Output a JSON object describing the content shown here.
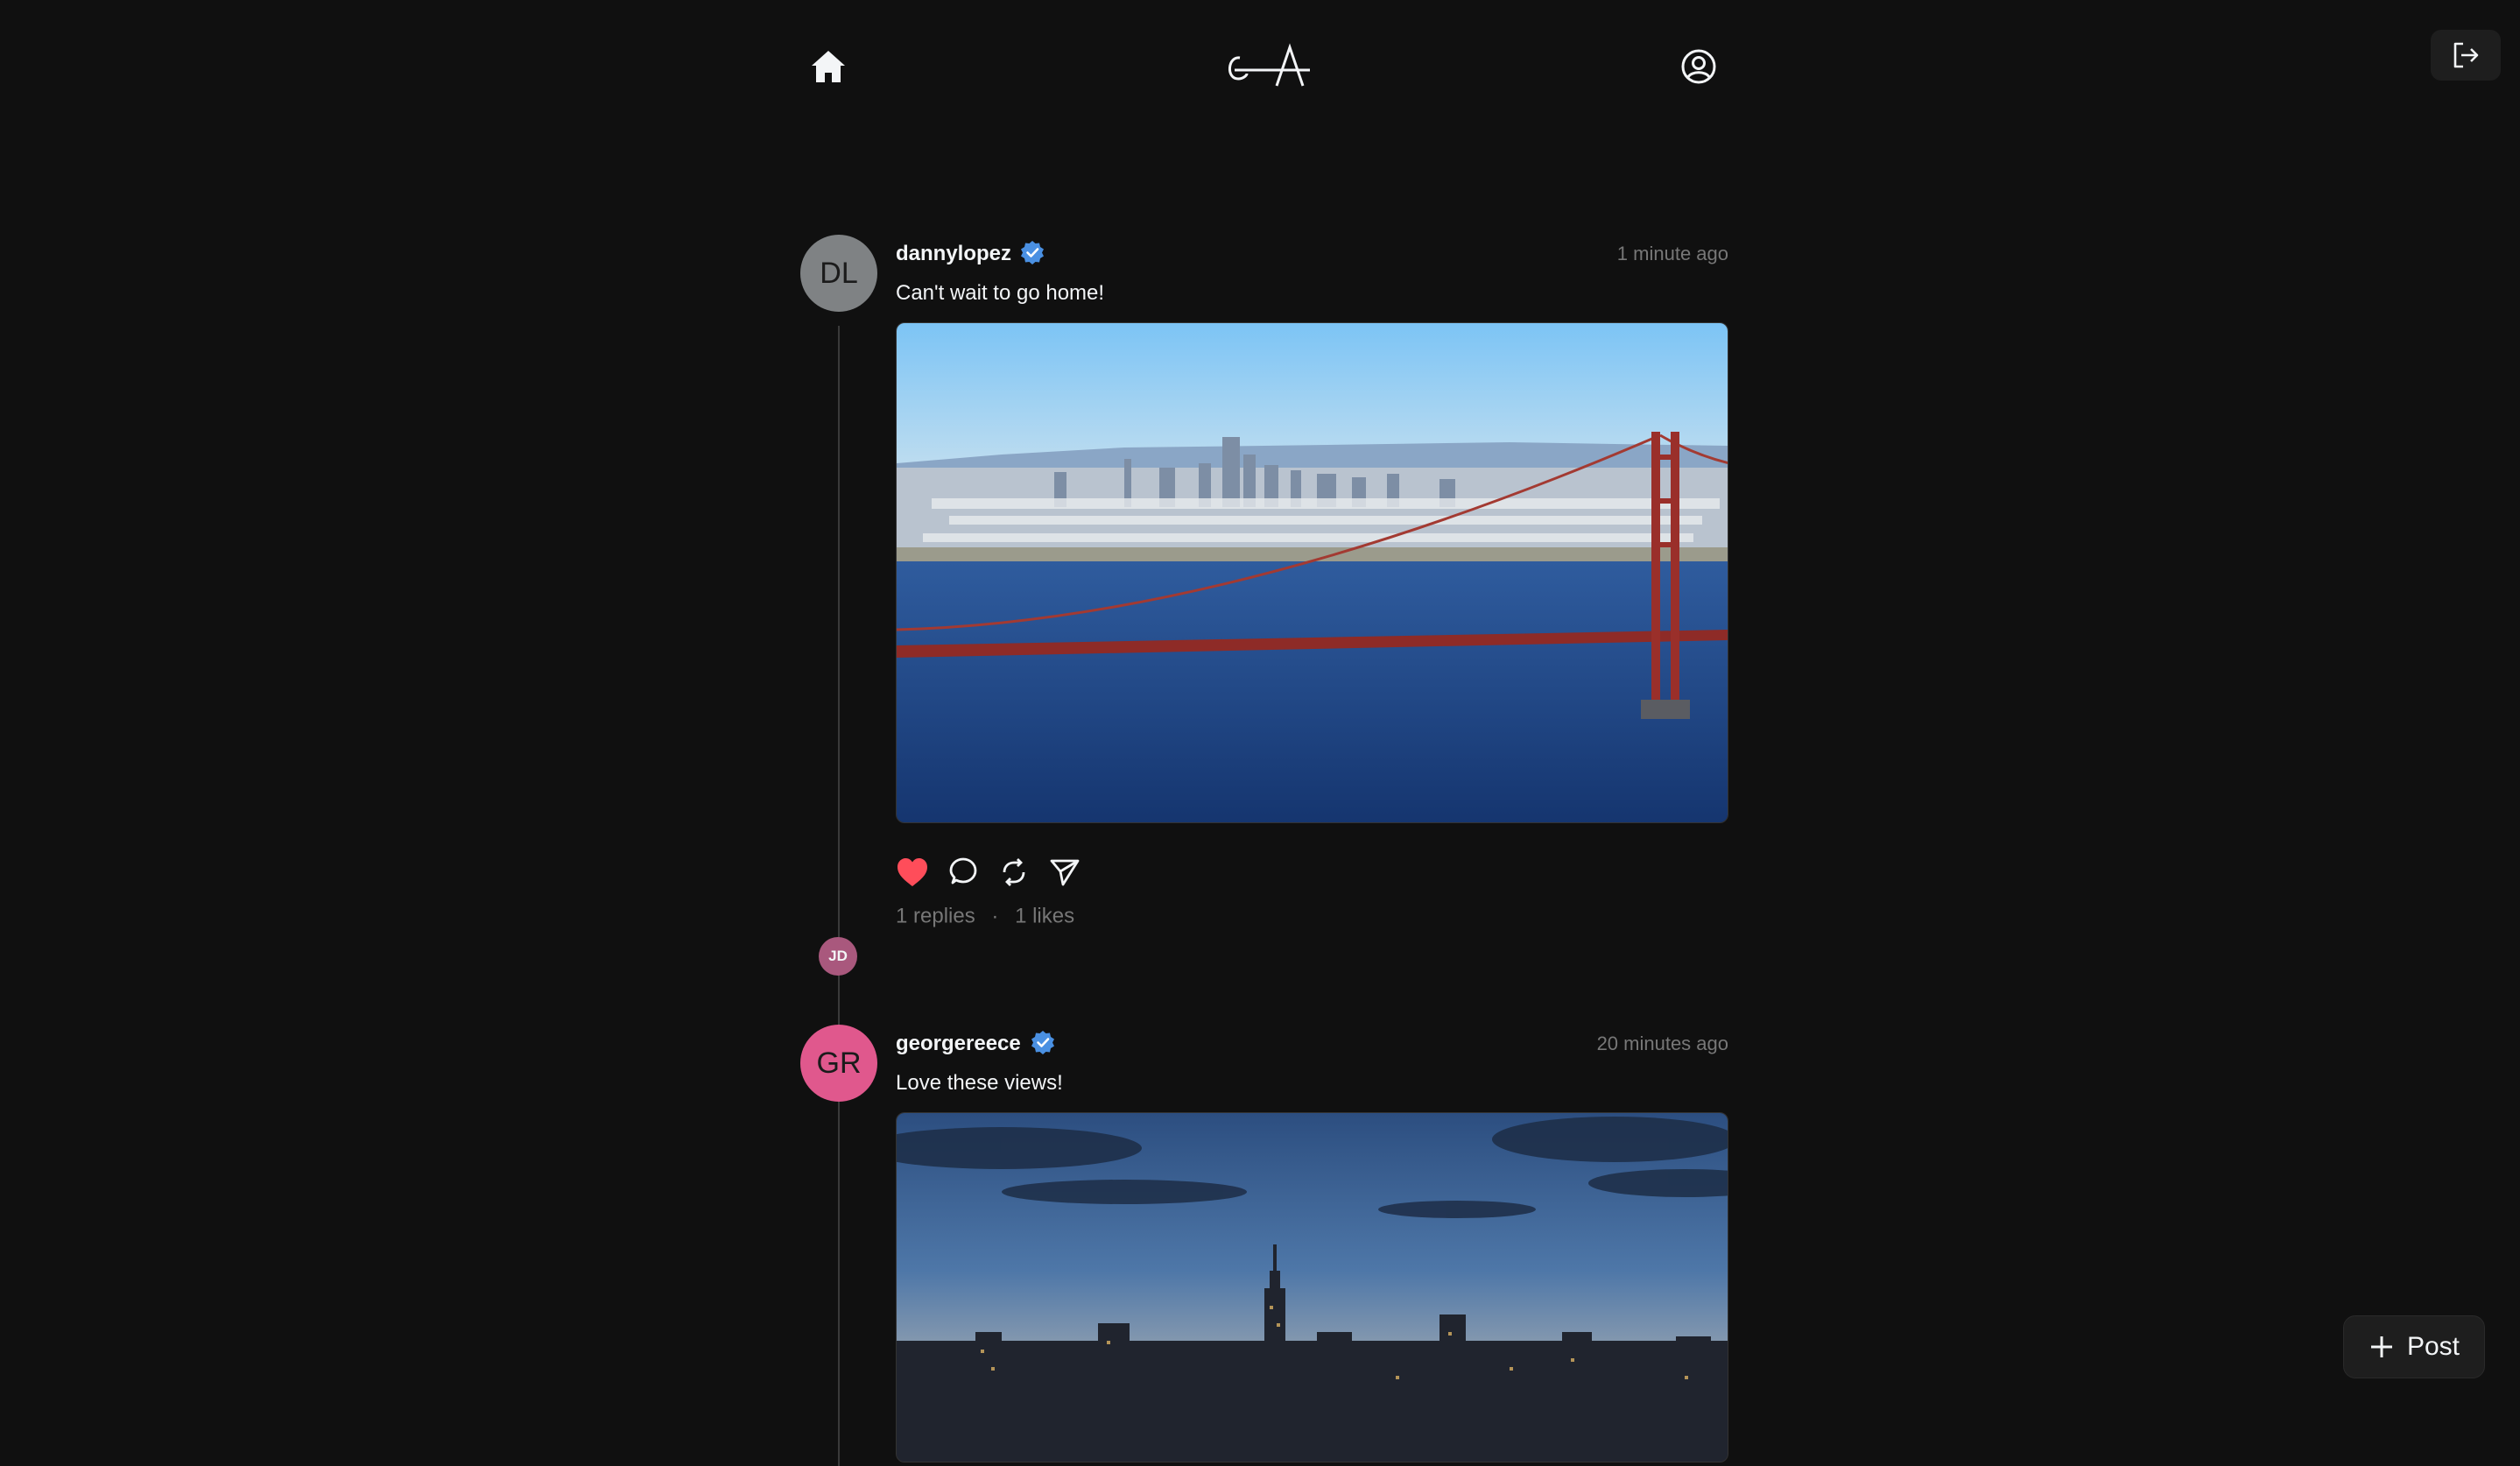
{
  "nav": {
    "home_icon": "home-icon",
    "logo_icon": "threads-logo",
    "profile_icon": "user-circle-icon",
    "logout_icon": "logout-icon"
  },
  "posts": [
    {
      "avatar_initials": "DL",
      "avatar_color": "#7f8284",
      "username": "dannylopez",
      "verified": true,
      "time": "1 minute ago",
      "text": "Can't wait to go home!",
      "image_subject": "Golden Gate Bridge and San Francisco skyline",
      "liked": true,
      "replies_label": "1 replies",
      "separator": "·",
      "likes_label": "1 likes",
      "reply_avatar_initials": "JD"
    },
    {
      "avatar_initials": "GR",
      "avatar_color": "#e0588d",
      "username": "georgereece",
      "verified": true,
      "time": "20 minutes ago",
      "text": "Love these views!",
      "image_subject": "New York City skyline at sunset"
    }
  ],
  "new_post": {
    "label": "Post",
    "icon": "plus-icon"
  },
  "colors": {
    "background": "#101010",
    "verified": "#4a90e2",
    "like": "#ff4d5a",
    "muted": "#777777"
  }
}
